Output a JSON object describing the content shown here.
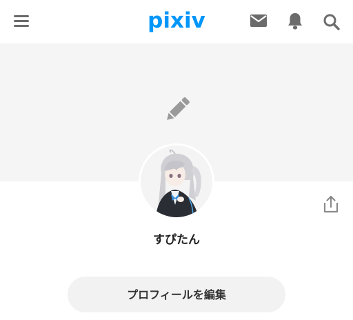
{
  "header": {
    "logo_text": "pixiv",
    "icons": [
      "menu-icon",
      "mail-icon",
      "bell-icon",
      "search-icon"
    ]
  },
  "cover": {
    "edit_icon": "pencil-icon"
  },
  "profile": {
    "username": "すぴたん",
    "share_icon": "share-icon",
    "edit_profile_label": "プロフィールを編集"
  },
  "colors": {
    "brand": "#0096fa",
    "icon_gray": "#6b6b6b",
    "cover_bg": "#f5f5f5",
    "button_bg": "#f2f2f2"
  }
}
